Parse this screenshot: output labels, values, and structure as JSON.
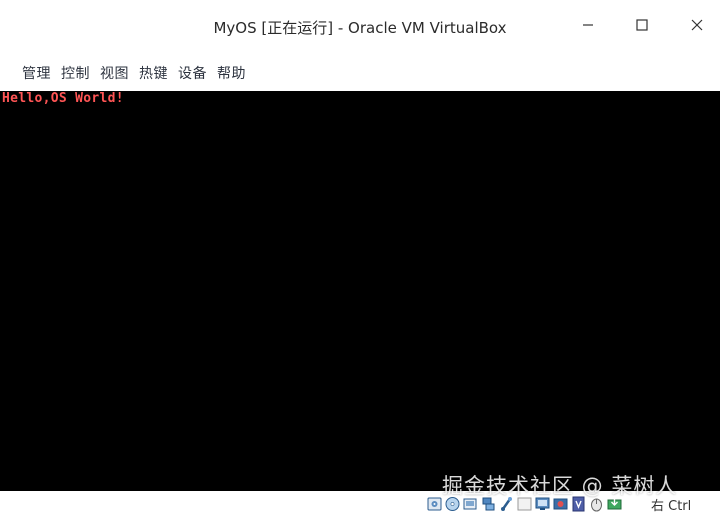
{
  "window": {
    "title": "MyOS [正在运行] - Oracle VM VirtualBox",
    "controls": [
      "minimize",
      "maximize",
      "close"
    ]
  },
  "menubar": {
    "items": [
      {
        "label": "管理"
      },
      {
        "label": "控制"
      },
      {
        "label": "视图"
      },
      {
        "label": "热键"
      },
      {
        "label": "设备"
      },
      {
        "label": "帮助"
      }
    ]
  },
  "vm_screen": {
    "output_text": "Hello,OS World!",
    "text_color": "#ff5555",
    "background": "#000000"
  },
  "statusbar": {
    "icons": [
      "hard-disk-icon",
      "optical-drive-icon",
      "audio-icon",
      "network-icon",
      "usb-icon",
      "shared-folders-icon",
      "display-icon",
      "video-capture-icon",
      "vt-x-icon",
      "mouse-integration-icon",
      "keyboard-icon"
    ],
    "host_key": "右 Ctrl"
  },
  "watermark": {
    "text": "掘金技术社区 @ 菜树人"
  }
}
